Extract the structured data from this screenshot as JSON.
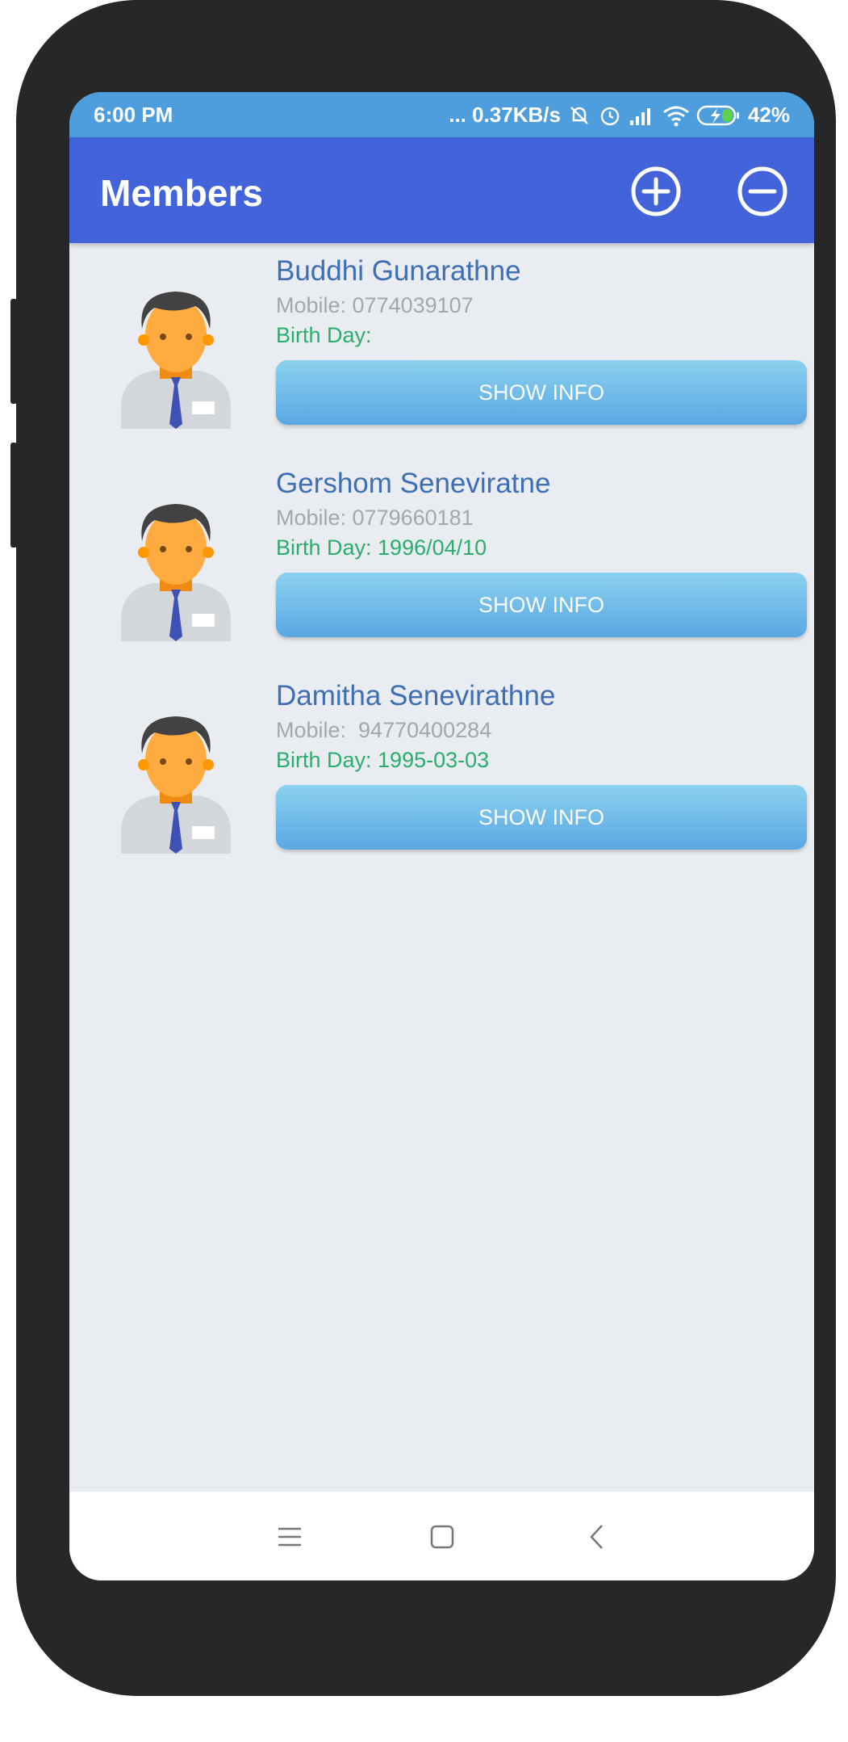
{
  "status_bar": {
    "time": "6:00 PM",
    "network_speed": "... 0.37KB/s",
    "battery": "42%",
    "icons": [
      "mute-icon",
      "alarm-icon",
      "signal-icon",
      "wifi-icon",
      "battery-charging-icon"
    ]
  },
  "app_bar": {
    "title": "Members",
    "add_icon": "plus-circle-icon",
    "remove_icon": "minus-circle-icon"
  },
  "members": [
    {
      "name": "Buddhi Gunarathne",
      "mobile": "Mobile: 0774039107",
      "birth_day": "Birth Day:",
      "button": "SHOW INFO"
    },
    {
      "name": "Gershom Seneviratne",
      "mobile": "Mobile: 0779660181",
      "birth_day": "Birth Day: 1996/04/10",
      "button": "SHOW INFO"
    },
    {
      "name": "Damitha Senevirathne",
      "mobile": "Mobile:  94770400284",
      "birth_day": "Birth Day: 1995-03-03",
      "button": "SHOW INFO"
    }
  ],
  "nav_bar": {
    "icons": [
      "menu-icon",
      "home-square-icon",
      "back-chevron-icon"
    ]
  },
  "colors": {
    "status_bar": "#4E9EDD",
    "app_bar": "#4263D9",
    "background": "#E9ECF0",
    "name_text": "#3E6FB4",
    "mobile_text": "#A3A8AE",
    "birth_text": "#2AAE6E",
    "button_top": "#8BD1EE",
    "button_bottom": "#5AA7E3"
  }
}
